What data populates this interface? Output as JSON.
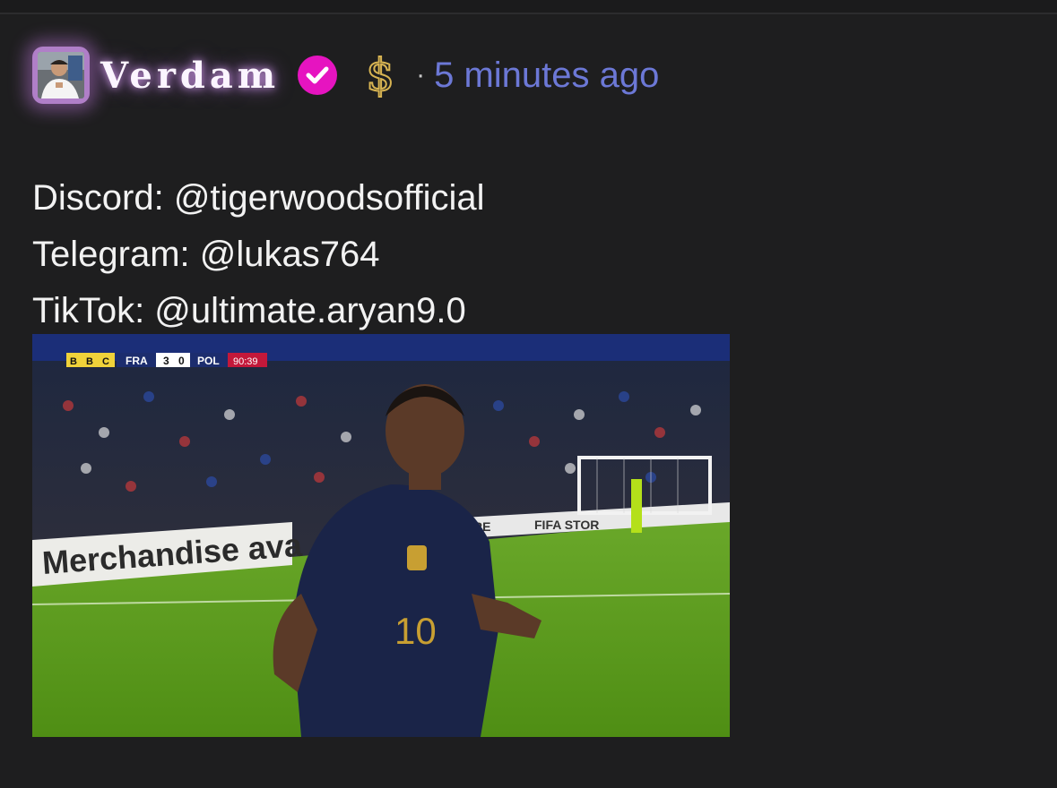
{
  "post": {
    "username": "Verdam",
    "separator": "·",
    "timestamp": "5 minutes ago",
    "badges": {
      "verified": {
        "icon": "check-badge-icon",
        "color": "#e614c0"
      },
      "currency": {
        "icon": "dollar-icon",
        "color": "#d8b452"
      }
    },
    "avatar": {
      "icon": "profile-photo-icon",
      "glow_color": "#b07fc8"
    },
    "lines": [
      "Discord: @tigerwoodsofficial",
      "Telegram: @lukas764",
      "TikTok: @ultimate.aryan9.0"
    ]
  },
  "media": {
    "broadcaster": "BBC",
    "home_team": "FRA",
    "home_score": "3",
    "away_score": "0",
    "away_team": "POL",
    "match_clock": "90:39",
    "banner_text": "Merchandise ava",
    "ad_text": "FIFA STOR",
    "ad_text_2": "RE",
    "jersey_number": "10"
  }
}
